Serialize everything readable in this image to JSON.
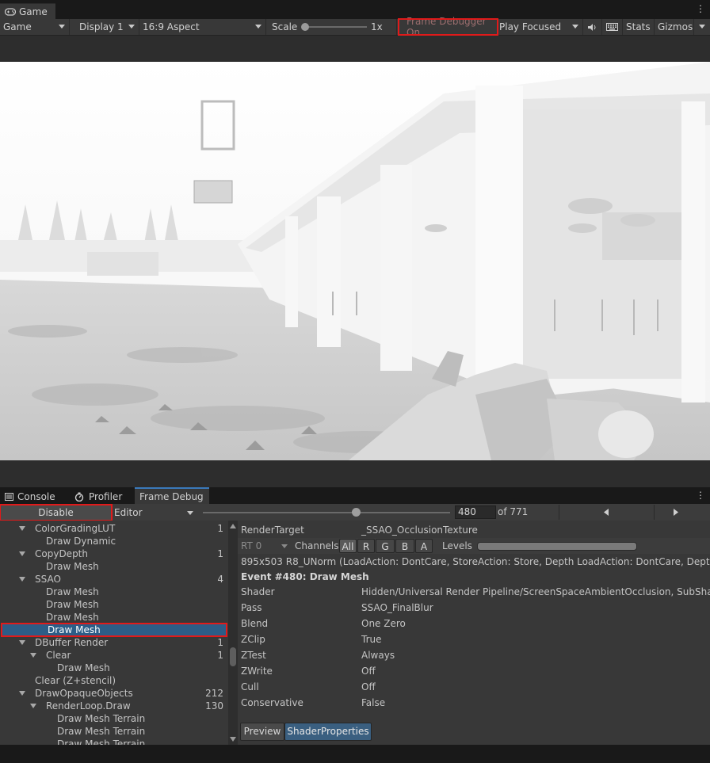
{
  "game_window": {
    "tab_label": "Game",
    "toolbar": {
      "mode": "Game",
      "display": "Display 1",
      "aspect": "16:9 Aspect",
      "scale_label": "Scale",
      "scale_value": "1x",
      "scale_level": 0.0,
      "frame_debugger": "Frame Debugger On",
      "play_mode": "Play Focused",
      "stats": "Stats",
      "gizmos": "Gizmos"
    }
  },
  "panel": {
    "tabs": [
      {
        "label": "Console",
        "icon": "console-icon"
      },
      {
        "label": "Profiler",
        "icon": "profiler-icon"
      },
      {
        "label": "Frame Debug",
        "icon": ""
      }
    ],
    "toolbar": {
      "disable_label": "Disable",
      "target": "Editor",
      "event_index": "480",
      "event_total": "of 771",
      "slider_level": 0.62
    },
    "tree": [
      {
        "label": "ColorGradingLUT",
        "count": "1",
        "depth": 2,
        "expanded": true
      },
      {
        "label": "Draw Dynamic",
        "count": "",
        "depth": 3
      },
      {
        "label": "CopyDepth",
        "count": "1",
        "depth": 2,
        "expanded": true
      },
      {
        "label": "Draw Mesh",
        "count": "",
        "depth": 3
      },
      {
        "label": "SSAO",
        "count": "4",
        "depth": 2,
        "expanded": true
      },
      {
        "label": "Draw Mesh",
        "count": "",
        "depth": 3
      },
      {
        "label": "Draw Mesh",
        "count": "",
        "depth": 3
      },
      {
        "label": "Draw Mesh",
        "count": "",
        "depth": 3
      },
      {
        "label": "Draw Mesh",
        "count": "",
        "depth": 3,
        "selected": true
      },
      {
        "label": "DBuffer Render",
        "count": "1",
        "depth": 2,
        "expanded": true
      },
      {
        "label": "Clear",
        "count": "1",
        "depth": 3,
        "expanded": true
      },
      {
        "label": "Draw Mesh",
        "count": "",
        "depth": 4
      },
      {
        "label": "Clear (Z+stencil)",
        "count": "",
        "depth": 2
      },
      {
        "label": "DrawOpaqueObjects",
        "count": "212",
        "depth": 2,
        "expanded": true
      },
      {
        "label": "RenderLoop.Draw",
        "count": "130",
        "depth": 3,
        "expanded": true
      },
      {
        "label": "Draw Mesh Terrain",
        "count": "",
        "depth": 4
      },
      {
        "label": "Draw Mesh Terrain",
        "count": "",
        "depth": 4
      },
      {
        "label": "Draw Mesh Terrain",
        "count": "",
        "depth": 4
      }
    ],
    "details": {
      "render_target_label": "RenderTarget",
      "render_target_value": "_SSAO_OcclusionTexture",
      "rt_select": "RT 0",
      "channels_label": "Channels",
      "channels": [
        "All",
        "R",
        "G",
        "B",
        "A"
      ],
      "levels_label": "Levels",
      "format_line": "895x503 R8_UNorm (LoadAction: DontCare, StoreAction: Store, Depth LoadAction: DontCare, Depth Stor",
      "event_title": "Event #480: Draw Mesh",
      "properties": [
        {
          "key": "Shader",
          "value": "Hidden/Universal Render Pipeline/ScreenSpaceAmbientOcclusion, SubShade"
        },
        {
          "key": "Pass",
          "value": "SSAO_FinalBlur"
        },
        {
          "key": "Blend",
          "value": "One Zero"
        },
        {
          "key": "ZClip",
          "value": "True"
        },
        {
          "key": "ZTest",
          "value": "Always"
        },
        {
          "key": "ZWrite",
          "value": "Off"
        },
        {
          "key": "Cull",
          "value": "Off"
        },
        {
          "key": "Conservative",
          "value": "False"
        }
      ],
      "preview_label": "Preview",
      "shader_props_label": "ShaderProperties"
    }
  },
  "colors": {
    "highlight_red": "#e11a1a",
    "selection_blue": "#2c5d87",
    "active_tab_blue": "#3a5f80"
  }
}
